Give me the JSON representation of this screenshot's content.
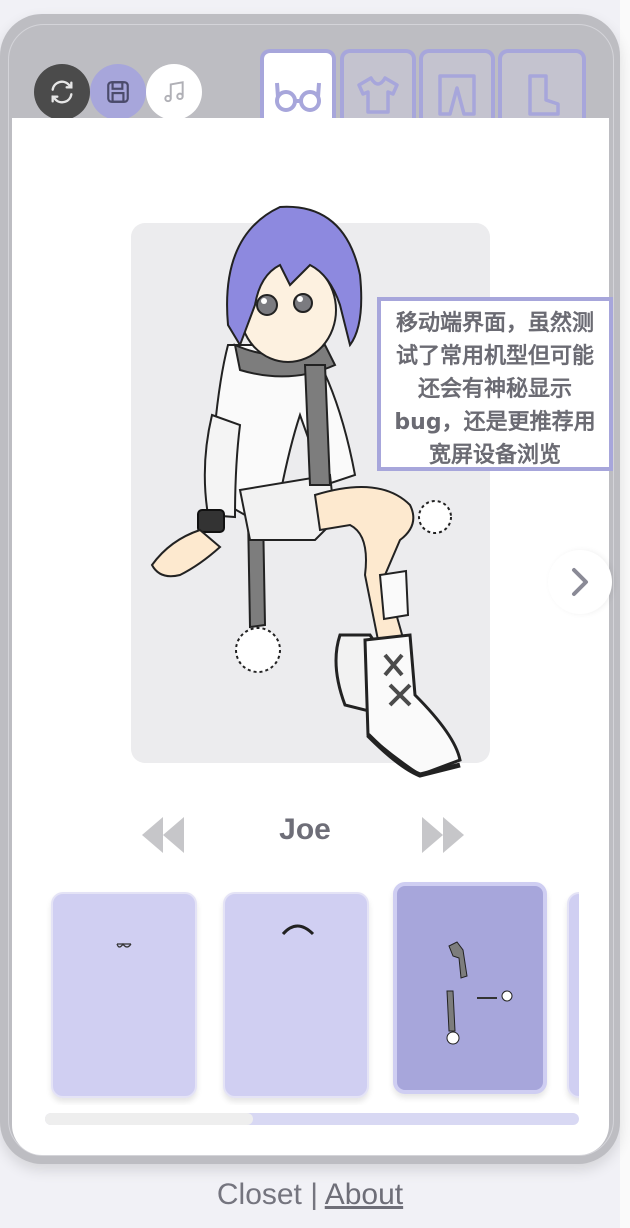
{
  "toolbar": {
    "buttons": [
      {
        "name": "refresh",
        "icon": "refresh-icon",
        "color": "#4b4b4b"
      },
      {
        "name": "save",
        "icon": "save-icon",
        "color": "#a7a6db"
      },
      {
        "name": "music",
        "icon": "music-icon",
        "color": "#ffffff"
      }
    ]
  },
  "tabs": [
    {
      "name": "glasses",
      "icon": "glasses-icon",
      "active": true
    },
    {
      "name": "shirt",
      "icon": "shirt-icon",
      "active": false
    },
    {
      "name": "pants",
      "icon": "pants-icon",
      "active": false
    },
    {
      "name": "shoes",
      "icon": "boot-icon",
      "active": false
    }
  ],
  "preview": {
    "notice_lines": [
      "移动端界面，虽然测",
      "试了常用机型但可能",
      "还会有神秘显示",
      "bug，还是更推荐用",
      "宽屏设备浏览"
    ]
  },
  "character": {
    "name": "Joe"
  },
  "items": {
    "selected_index": 2,
    "scroll_fraction": 0.39
  },
  "footer": {
    "closet": "Closet",
    "separator": "|",
    "about": "About"
  },
  "colors": {
    "accent": "#a7a6db",
    "accent_light": "#d0cff2",
    "frame": "#bdbdc2",
    "text": "#6e6e78"
  }
}
